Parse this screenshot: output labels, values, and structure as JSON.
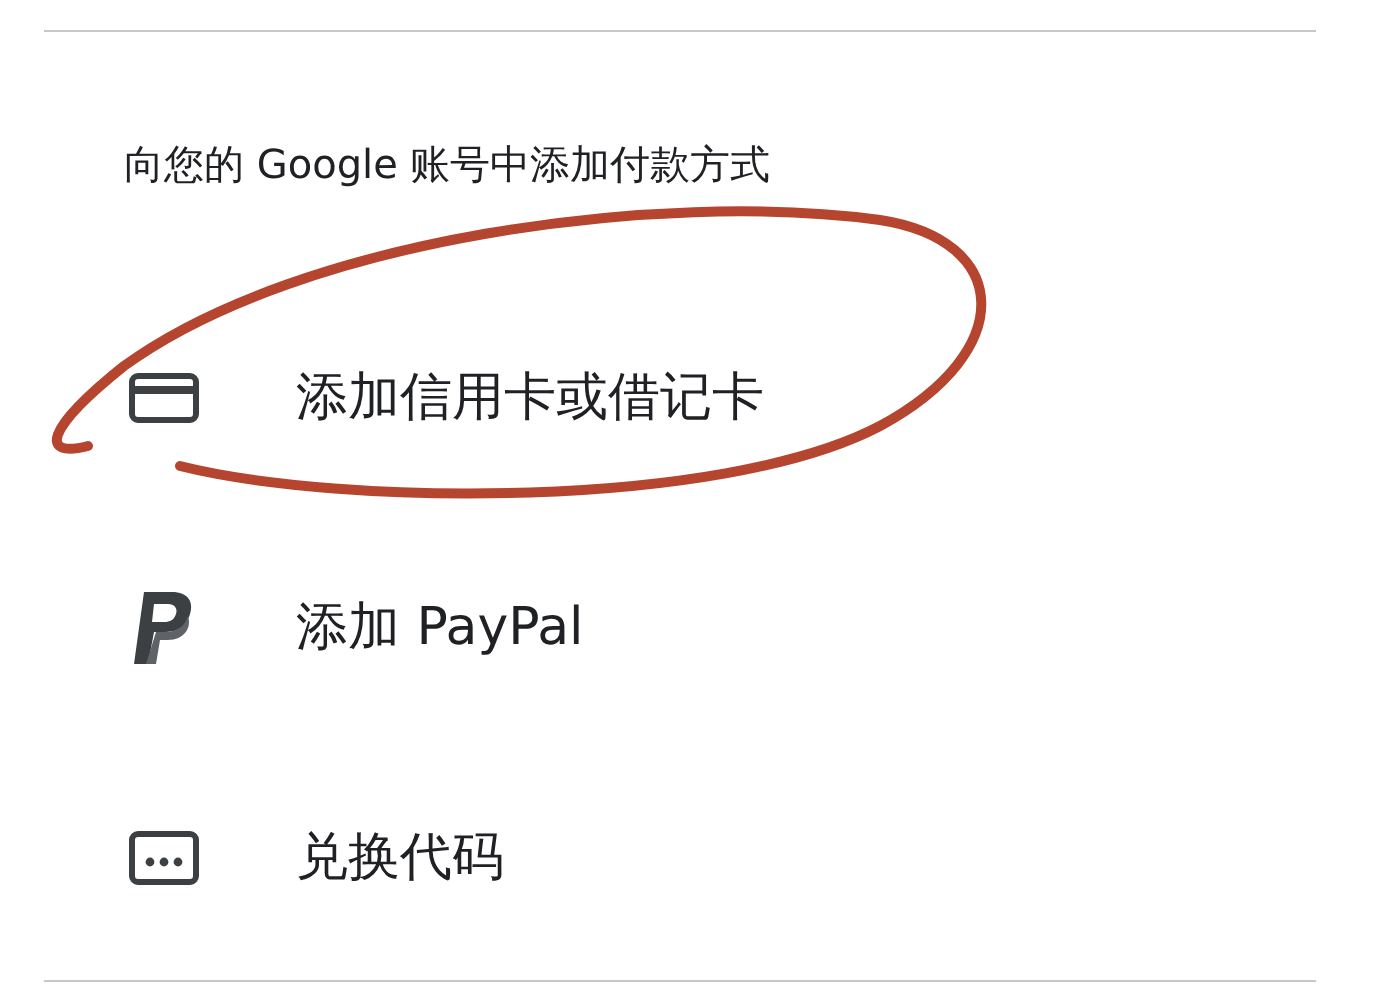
{
  "heading": "向您的 Google 账号中添加付款方式",
  "options": [
    {
      "kind": "card",
      "label": "添加信用卡或借记卡"
    },
    {
      "kind": "paypal",
      "label": "添加 PayPal"
    },
    {
      "kind": "code",
      "label": "兑换代码"
    }
  ]
}
